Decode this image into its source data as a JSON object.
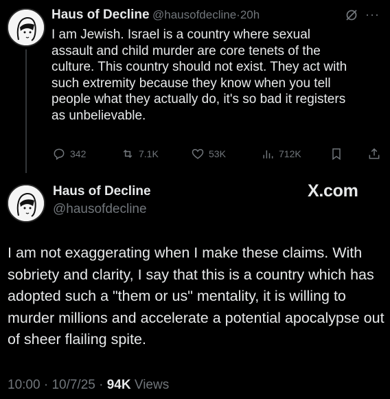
{
  "tweet1": {
    "display_name": "Haus of Decline",
    "handle": "@hausofdecline",
    "separator": "·",
    "time": "20h",
    "text": "I am Jewish. Israel is a country where sexual assault and child murder are core tenets of the culture. This country should not exist. They act with such extremity because they know when you tell people what they actually do, it's so bad it registers as unbelievable.",
    "actions": {
      "replies": "342",
      "reposts": "7.1K",
      "likes": "53K",
      "views": "712K"
    }
  },
  "tweet2": {
    "display_name": "Haus of Decline",
    "handle": "@hausofdecline",
    "brand": "X.com",
    "text": "I am not exaggerating when I make these claims. With sobriety and clarity, I say that this is a country which has adopted such a \"them or us\" mentality, it is willing to murder millions and accelerate a potential apocalypse out of sheer flailing spite.",
    "meta": {
      "time": "10:00",
      "sep1": "·",
      "date": "10/7/25",
      "sep2": "·",
      "views_count": "94K",
      "views_label": "Views"
    }
  },
  "colors": {
    "background": "#000000",
    "text": "#e7e9ea",
    "muted": "#71767b"
  }
}
